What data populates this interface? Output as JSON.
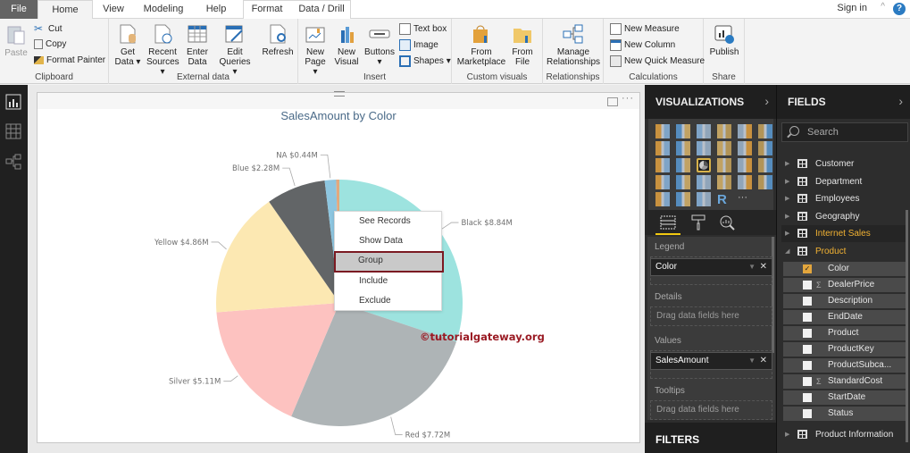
{
  "tabs": {
    "file": "File",
    "home": "Home",
    "view": "View",
    "modeling": "Modeling",
    "help": "Help",
    "format": "Format",
    "data_drill": "Data / Drill"
  },
  "topright": {
    "signin": "Sign in",
    "help": "?"
  },
  "ribbon": {
    "clipboard": {
      "label": "Clipboard",
      "paste": "Paste",
      "cut": "Cut",
      "copy": "Copy",
      "format_painter": "Format Painter"
    },
    "external_data": {
      "label": "External data",
      "get_data": "Get Data ▾",
      "recent_sources": "Recent Sources ▾",
      "enter_data": "Enter Data",
      "edit_queries": "Edit Queries ▾",
      "refresh": "Refresh"
    },
    "insert": {
      "label": "Insert",
      "new_page": "New Page ▾",
      "new_visual": "New Visual",
      "buttons": "Buttons ▾",
      "text_box": "Text box",
      "image": "Image",
      "shapes": "Shapes ▾"
    },
    "custom_visuals": {
      "label": "Custom visuals",
      "from_marketplace": "From Marketplace",
      "from_file": "From File"
    },
    "relationships": {
      "label": "Relationships",
      "manage": "Manage Relationships"
    },
    "calculations": {
      "label": "Calculations",
      "new_measure": "New Measure",
      "new_column": "New Column",
      "new_quick_measure": "New Quick Measure"
    },
    "share": {
      "label": "Share",
      "publish": "Publish"
    }
  },
  "chart_data": {
    "type": "pie",
    "title": "SalesAmount by Color",
    "categories": [
      "Black",
      "Red",
      "Silver",
      "Yellow",
      "Blue",
      "NA",
      ""
    ],
    "values": [
      8.84,
      7.72,
      5.11,
      4.86,
      2.28,
      0.44,
      0.12
    ],
    "labels": [
      "Black $8.84M",
      "Red $7.72M",
      "Silver $5.11M",
      "Yellow $4.86M",
      "Blue $2.28M",
      "NA $0.44M",
      ""
    ],
    "colors": [
      "#9de3df",
      "#aeb4b6",
      "#fdc2c0",
      "#fce8b2",
      "#626567",
      "#8dc6e0",
      "#e2a87e"
    ],
    "unit": "$M",
    "start_angle": "12 o'clock, clockwise"
  },
  "context_menu": {
    "items": [
      "See Records",
      "Show Data",
      "Group",
      "Include",
      "Exclude"
    ],
    "selected": "Group"
  },
  "watermark": "©tutorialgateway.org",
  "visualizations": {
    "title": "VISUALIZATIONS",
    "wells": {
      "legend": {
        "label": "Legend",
        "field": "Color"
      },
      "details": {
        "label": "Details",
        "placeholder": "Drag data fields here"
      },
      "values": {
        "label": "Values",
        "field": "SalesAmount"
      },
      "tooltips": {
        "label": "Tooltips",
        "placeholder": "Drag data fields here"
      }
    },
    "filters_title": "FILTERS"
  },
  "fields": {
    "title": "FIELDS",
    "search_placeholder": "Search",
    "tables_before": [
      "Customer",
      "Department",
      "Employees",
      "Geography",
      "Internet Sales"
    ],
    "expanded_table": "Product",
    "product_fields": [
      {
        "name": "Color",
        "checked": true,
        "sigma": false
      },
      {
        "name": "DealerPrice",
        "checked": false,
        "sigma": true
      },
      {
        "name": "Description",
        "checked": false,
        "sigma": false
      },
      {
        "name": "EndDate",
        "checked": false,
        "sigma": false
      },
      {
        "name": "Product",
        "checked": false,
        "sigma": false
      },
      {
        "name": "ProductKey",
        "checked": false,
        "sigma": false
      },
      {
        "name": "ProductSubca...",
        "checked": false,
        "sigma": false
      },
      {
        "name": "StandardCost",
        "checked": false,
        "sigma": true
      },
      {
        "name": "StartDate",
        "checked": false,
        "sigma": false
      },
      {
        "name": "Status",
        "checked": false,
        "sigma": false
      }
    ],
    "tables_after": [
      "Product Information"
    ]
  }
}
